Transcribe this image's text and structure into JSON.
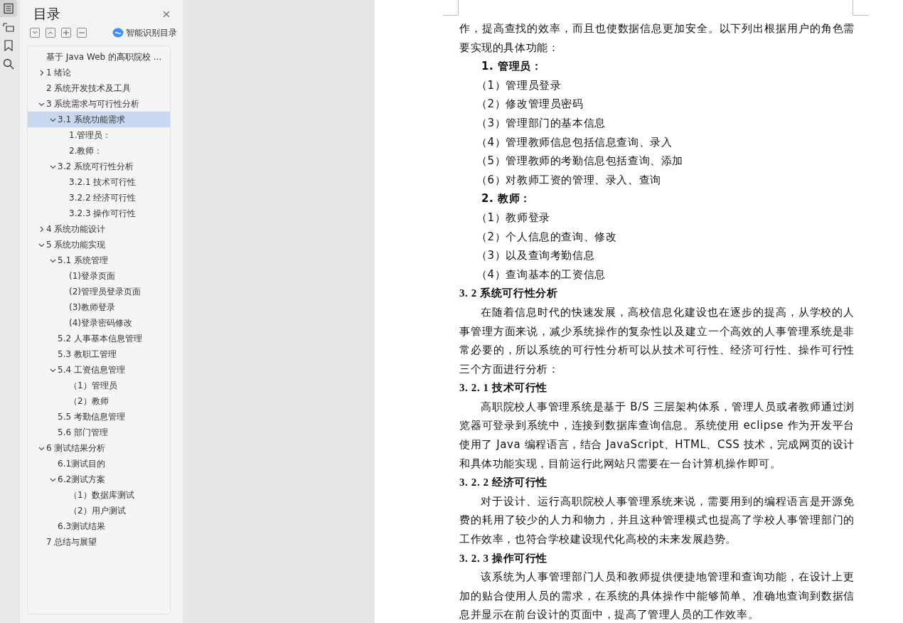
{
  "rail": {
    "items": [
      {
        "kind": "toc",
        "selected": true
      },
      {
        "kind": "outline",
        "selected": false
      },
      {
        "kind": "bookmark",
        "selected": false
      },
      {
        "kind": "search",
        "selected": false
      }
    ]
  },
  "toc_panel": {
    "title": "目录",
    "smart_button": "智能识别目录",
    "items": [
      {
        "label": "基于 Java Web 的高职院校 ...",
        "selected": false
      },
      {
        "label": "1  绪论",
        "selected": false,
        "expanded": false
      },
      {
        "label": "2  系统开发技术及工具",
        "selected": false
      },
      {
        "label": "3  系统需求与可行性分析",
        "selected": false,
        "expanded": true,
        "children": [
          {
            "label": "3.1  系统功能需求",
            "selected": true,
            "expanded": true,
            "children": [
              {
                "label": "1.管理员：",
                "selected": false
              },
              {
                "label": "2.教师：",
                "selected": false
              }
            ]
          },
          {
            "label": "3.2  系统可行性分析",
            "selected": false,
            "expanded": true,
            "children": [
              {
                "label": "3.2.1  技术可行性",
                "selected": false
              },
              {
                "label": "3.2.2  经济可行性",
                "selected": false
              },
              {
                "label": "3.2.3  操作可行性",
                "selected": false
              }
            ]
          }
        ]
      },
      {
        "label": "4  系统功能设计",
        "selected": false,
        "expanded": false
      },
      {
        "label": "5  系统功能实现",
        "selected": false,
        "expanded": true,
        "children": [
          {
            "label": "5.1 系统管理",
            "selected": false,
            "expanded": true,
            "children": [
              {
                "label": "(1)登录页面",
                "selected": false
              },
              {
                "label": "(2)管理员登录页面",
                "selected": false
              },
              {
                "label": "(3)教师登录",
                "selected": false
              },
              {
                "label": "(4)登录密码修改",
                "selected": false
              }
            ]
          },
          {
            "label": "5.2 人事基本信息管理",
            "selected": false
          },
          {
            "label": "5.3 教职工管理",
            "selected": false
          },
          {
            "label": "5.4 工资信息管理",
            "selected": false,
            "expanded": true,
            "children": [
              {
                "label": "（1）管理员",
                "selected": false
              },
              {
                "label": "（2）教师",
                "selected": false
              }
            ]
          },
          {
            "label": "5.5 考勤信息管理",
            "selected": false
          },
          {
            "label": "5.6 部门管理",
            "selected": false
          }
        ]
      },
      {
        "label": "6  测试结果分析",
        "selected": false,
        "expanded": true,
        "children": [
          {
            "label": "6.1测试目的",
            "selected": false
          },
          {
            "label": "6.2测试方案",
            "selected": false,
            "expanded": true,
            "children": [
              {
                "label": "（1）数据库测试",
                "selected": false
              },
              {
                "label": "（2）用户测试",
                "selected": false
              }
            ]
          },
          {
            "label": "6.3测试结果",
            "selected": false
          }
        ]
      },
      {
        "label": "7  总结与展望",
        "selected": false
      }
    ]
  },
  "document": {
    "blocks": [
      {
        "kind": "continuation",
        "text": "作，提高查找的效率，而且也使数据信息更加安全。以下列出根据用户的角色需要实现的具体功能："
      },
      {
        "kind": "list-heading",
        "text": "1. 管理员："
      },
      {
        "kind": "list-item",
        "text": "（1）管理员登录"
      },
      {
        "kind": "list-item",
        "text": "（2）修改管理员密码"
      },
      {
        "kind": "list-item",
        "text": "（3）管理部门的基本信息"
      },
      {
        "kind": "list-item",
        "text": "（4）管理教师信息包括信息查询、录入"
      },
      {
        "kind": "list-item",
        "text": "（5）管理教师的考勤信息包括查询、添加"
      },
      {
        "kind": "list-item",
        "text": "（6）对教师工资的管理、录入、查询"
      },
      {
        "kind": "list-heading",
        "text": "2. 教师："
      },
      {
        "kind": "list-item",
        "text": "（1）教师登录"
      },
      {
        "kind": "list-item",
        "text": "（2）个人信息的查询、修改"
      },
      {
        "kind": "list-item",
        "text": "（3）以及查询考勤信息"
      },
      {
        "kind": "list-item",
        "text": "（4）查询基本的工资信息"
      },
      {
        "kind": "heading",
        "text": "3. 2  系统可行性分析"
      },
      {
        "kind": "paragraph",
        "text": "在随着信息时代的快速发展，高校信息化建设也在逐步的提高，从学校的人事管理方面来说，减少系统操作的复杂性以及建立一个高效的人事管理系统是非常必要的，所以系统的可行性分析可以从技术可行性、经济可行性、操作可行性三个方面进行分析："
      },
      {
        "kind": "subheading",
        "text": "3. 2. 1 技术可行性"
      },
      {
        "kind": "paragraph",
        "text": "高职院校人事管理系统是基于 B/S 三层架构体系，管理人员或者教师通过浏览器可登录到系统中，连接到数据库查询信息。系统使用 eclipse 作为开发平台使用了 Java 编程语言，结合 JavaScript、HTML、CSS 技术，完成网页的设计和具体功能实现，目前运行此网站只需要在一台计算机操作即可。"
      },
      {
        "kind": "subheading",
        "text": "3. 2. 2 经济可行性"
      },
      {
        "kind": "paragraph",
        "text": "对于设计、运行高职院校人事管理系统来说，需要用到的编程语言是开源免费的耗用了较少的人力和物力，并且这种管理模式也提高了学校人事管理部门的工作效率，也符合学校建设现代化高校的未来发展趋势。"
      },
      {
        "kind": "subheading",
        "text": "3. 2. 3 操作可行性"
      },
      {
        "kind": "paragraph",
        "text": "该系统为人事管理部门人员和教师提供便捷地管理和查询功能，在设计上更加的贴合使用人员的需求，在系统的具体操作中能够简单、准确地查询到数据信息并显示在前台设计的页面中，提高了管理人员的工作效率。"
      }
    ]
  }
}
